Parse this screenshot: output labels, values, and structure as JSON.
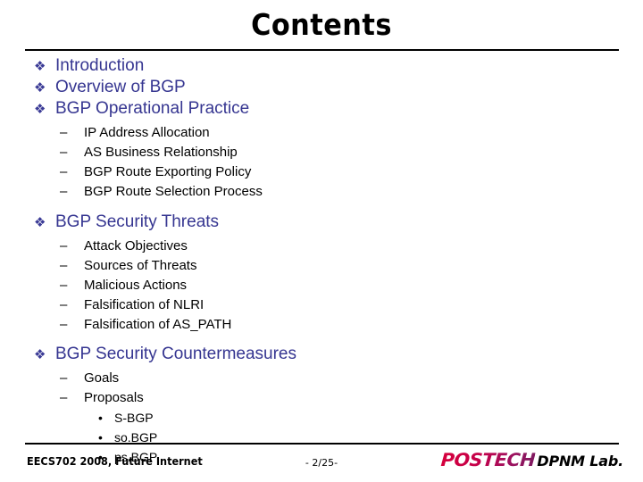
{
  "slide": {
    "title": "Contents",
    "page_number": "- 2/25-",
    "footer_text": "EECS702 2008, Future Internet",
    "logo_primary": "POSTECH",
    "logo_secondary": "DPNM Lab.",
    "bullet_glyph_level1": "❖",
    "bullet_glyph_level2": "–",
    "bullet_glyph_level3": "•",
    "colors": {
      "level1_text": "#363691",
      "level1_bullet": "#3b3b96",
      "level2_text": "#000000",
      "level3_text": "#000000",
      "title": "#000000",
      "rule": "#000000",
      "logo_primary_start": "#d6003c",
      "logo_primary_end": "#7d1a60",
      "logo_secondary": "#000000"
    },
    "outline": [
      {
        "level": 1,
        "text": "Introduction"
      },
      {
        "level": 1,
        "text": "Overview of BGP"
      },
      {
        "level": 1,
        "text": "BGP Operational Practice"
      },
      {
        "level": 2,
        "text": "IP Address Allocation"
      },
      {
        "level": 2,
        "text": "AS Business Relationship"
      },
      {
        "level": 2,
        "text": "BGP Route Exporting Policy"
      },
      {
        "level": 2,
        "text": "BGP Route Selection Process"
      },
      {
        "level": 1,
        "text": "BGP Security Threats"
      },
      {
        "level": 2,
        "text": "Attack Objectives"
      },
      {
        "level": 2,
        "text": "Sources of Threats"
      },
      {
        "level": 2,
        "text": "Malicious Actions"
      },
      {
        "level": 2,
        "text": "Falsification of NLRI"
      },
      {
        "level": 2,
        "text": "Falsification of AS_PATH"
      },
      {
        "level": 1,
        "text": "BGP Security Countermeasures"
      },
      {
        "level": 2,
        "text": "Goals"
      },
      {
        "level": 2,
        "text": "Proposals"
      },
      {
        "level": 3,
        "text": "S-BGP"
      },
      {
        "level": 3,
        "text": "so.BGP"
      },
      {
        "level": 3,
        "text": "ps.BGP"
      }
    ]
  }
}
